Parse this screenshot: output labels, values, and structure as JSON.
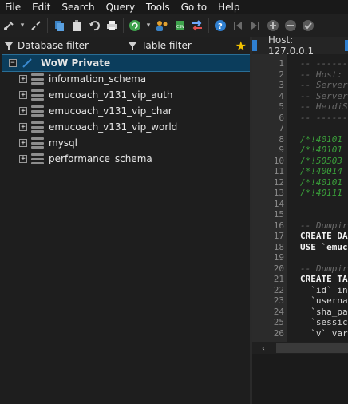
{
  "menu": [
    "File",
    "Edit",
    "Search",
    "Query",
    "Tools",
    "Go to",
    "Help"
  ],
  "toolbar": {
    "icons": [
      "connect-icon",
      "dropdown-arrow-icon",
      "disconnect-icon",
      "copy-icon",
      "paste-icon",
      "undo-icon",
      "print-icon",
      "refresh-icon",
      "dropdown-arrow-icon",
      "user-manager-icon",
      "export-csv-icon",
      "transfer-icon",
      "help-icon",
      "first-icon",
      "last-icon",
      "add-icon",
      "delete-icon",
      "check-icon"
    ]
  },
  "filters": {
    "database_filter": "Database filter",
    "table_filter": "Table filter"
  },
  "tree": {
    "root": "WoW Private",
    "databases": [
      "information_schema",
      "emucoach_v131_vip_auth",
      "emucoach_v131_vip_char",
      "emucoach_v131_vip_world",
      "mysql",
      "performance_schema"
    ]
  },
  "tab": {
    "title": "Host: 127.0.0.1"
  },
  "editor": {
    "lines": [
      {
        "n": "1",
        "t": "-- -------",
        "k": "comment"
      },
      {
        "n": "2",
        "t": "-- Host:",
        "k": "comment"
      },
      {
        "n": "3",
        "t": "-- Server",
        "k": "comment"
      },
      {
        "n": "4",
        "t": "-- Server",
        "k": "comment"
      },
      {
        "n": "5",
        "t": "-- HeidiS",
        "k": "comment"
      },
      {
        "n": "6",
        "t": "-- -------",
        "k": "comment"
      },
      {
        "n": "7",
        "t": "",
        "k": "plain"
      },
      {
        "n": "8",
        "t": "/*!40101",
        "k": "cond"
      },
      {
        "n": "9",
        "t": "/*!40101",
        "k": "cond"
      },
      {
        "n": "10",
        "t": "/*!50503",
        "k": "cond"
      },
      {
        "n": "11",
        "t": "/*!40014",
        "k": "cond"
      },
      {
        "n": "12",
        "t": "/*!40101",
        "k": "cond"
      },
      {
        "n": "13",
        "t": "/*!40111",
        "k": "cond"
      },
      {
        "n": "14",
        "t": "",
        "k": "plain"
      },
      {
        "n": "15",
        "t": "",
        "k": "plain"
      },
      {
        "n": "16",
        "t": "-- Dumpir",
        "k": "comment"
      },
      {
        "n": "17",
        "t": "CREATE DA",
        "k": "kw"
      },
      {
        "n": "18",
        "t": "USE `emuc",
        "k": "kwstr"
      },
      {
        "n": "19",
        "t": "",
        "k": "plain"
      },
      {
        "n": "20",
        "t": "-- Dumpir",
        "k": "comment"
      },
      {
        "n": "21",
        "t": "CREATE TA",
        "k": "kw"
      },
      {
        "n": "22",
        "t": "  `id` in",
        "k": "id"
      },
      {
        "n": "23",
        "t": "  `userna",
        "k": "id"
      },
      {
        "n": "24",
        "t": "  `sha_pa",
        "k": "id"
      },
      {
        "n": "25",
        "t": "  `sessic",
        "k": "id"
      },
      {
        "n": "26",
        "t": "  `v` var",
        "k": "id"
      }
    ]
  },
  "colors": {
    "selected_bg": "#0b3d5c",
    "comment": "#6b6b6b",
    "conditional": "#3aa03a",
    "string": "#6ea8ff"
  }
}
